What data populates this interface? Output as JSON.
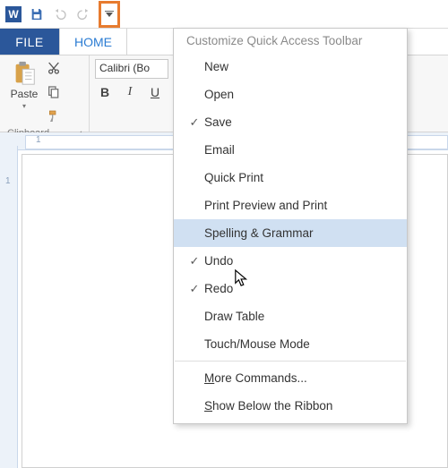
{
  "qat": {
    "save_tip": "Save",
    "undo_tip": "Undo",
    "redo_tip": "Redo"
  },
  "tabs": {
    "file": "FILE",
    "home": "HOME"
  },
  "ribbon": {
    "paste_label": "Paste",
    "clipboard_group": "Clipboard",
    "font_name": "Calibri (Bo",
    "bold": "B",
    "italic": "I",
    "underline": "U"
  },
  "menu": {
    "title": "Customize Quick Access Toolbar",
    "items": [
      {
        "label": "New",
        "checked": false
      },
      {
        "label": "Open",
        "checked": false
      },
      {
        "label": "Save",
        "checked": true
      },
      {
        "label": "Email",
        "checked": false
      },
      {
        "label": "Quick Print",
        "checked": false
      },
      {
        "label": "Print Preview and Print",
        "checked": false
      },
      {
        "label": "Spelling & Grammar",
        "checked": false,
        "hover": true
      },
      {
        "label": "Undo",
        "checked": true
      },
      {
        "label": "Redo",
        "checked": true
      },
      {
        "label": "Draw Table",
        "checked": false
      },
      {
        "label": "Touch/Mouse Mode",
        "checked": false
      }
    ],
    "more_commands_html": "<u>M</u>ore Commands...",
    "show_below_html": "<u>S</u>how Below the Ribbon"
  },
  "ruler": {
    "mark": "1"
  }
}
